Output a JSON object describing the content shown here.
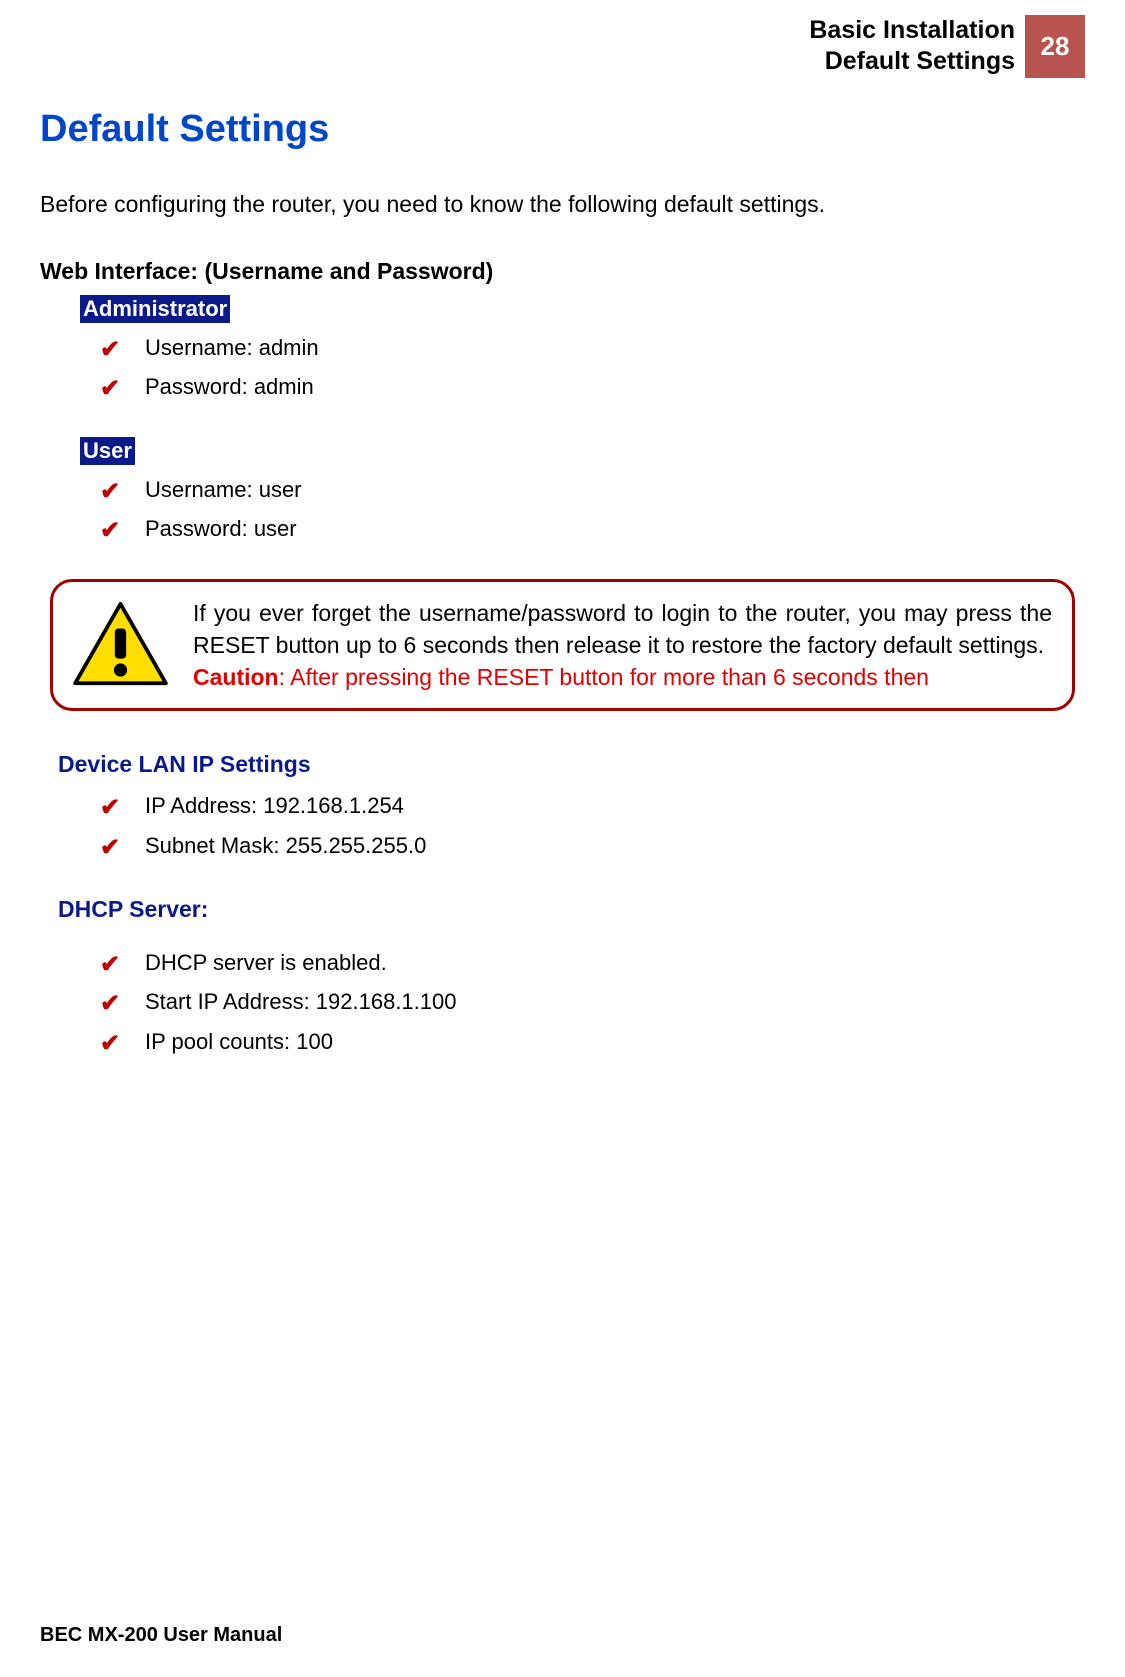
{
  "header": {
    "line1": "Basic Installation",
    "line2": "Default Settings",
    "page_number": "28"
  },
  "title": "Default Settings",
  "intro": "Before configuring the router, you need to know the following default settings.",
  "web_interface": {
    "label": "Web Interface: (Username and Password)",
    "admin": {
      "role": "Administrator",
      "username": "Username: admin",
      "password": "Password: admin"
    },
    "user": {
      "role": "User",
      "username": "Username: user",
      "password": "Password: user"
    }
  },
  "warning": {
    "body": "If you ever forget the username/password to login to the router, you may press the RESET button up to 6 seconds then release it to restore the factory default settings.",
    "caution_label": "Caution",
    "caution_rest": ": After pressing the RESET button for more than 6 seconds then"
  },
  "lan": {
    "title": "Device LAN IP Settings",
    "ip": "IP Address: 192.168.1.254",
    "mask": "Subnet Mask: 255.255.255.0"
  },
  "dhcp": {
    "title": "DHCP Server:",
    "enabled": "DHCP server is enabled.",
    "start": "Start IP Address: 192.168.1.100",
    "pool": "IP pool counts: 100"
  },
  "footer": "BEC MX-200 User Manual"
}
